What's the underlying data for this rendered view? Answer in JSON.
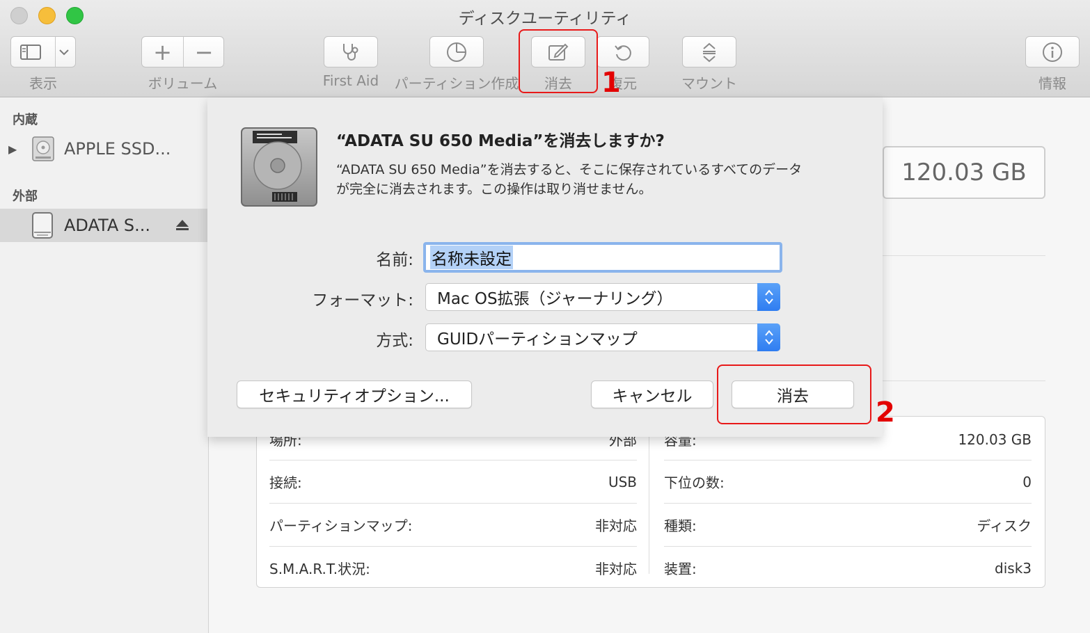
{
  "window": {
    "title": "ディスクユーティリティ"
  },
  "toolbar": {
    "view_label": "表示",
    "volume_label": "ボリューム",
    "first_aid_label": "First Aid",
    "partition_label": "パーティション作成",
    "erase_label": "消去",
    "restore_label": "復元",
    "mount_label": "マウント",
    "info_label": "情報"
  },
  "sidebar": {
    "internal_header": "内蔵",
    "internal_items": [
      {
        "label": "APPLE SSD..."
      }
    ],
    "external_header": "外部",
    "external_items": [
      {
        "label": "ADATA S..."
      }
    ]
  },
  "detail": {
    "capacity": "120.03 GB",
    "info_left": [
      {
        "label": "場所:",
        "value": "外部"
      },
      {
        "label": "接続:",
        "value": "USB"
      },
      {
        "label": "パーティションマップ:",
        "value": "非対応"
      },
      {
        "label": "S.M.A.R.T.状況:",
        "value": "非対応"
      }
    ],
    "info_right": [
      {
        "label": "容量:",
        "value": "120.03 GB"
      },
      {
        "label": "下位の数:",
        "value": "0"
      },
      {
        "label": "種類:",
        "value": "ディスク"
      },
      {
        "label": "装置:",
        "value": "disk3"
      }
    ]
  },
  "dialog": {
    "title": "“ADATA SU 650 Media”を消去しますか?",
    "message_line1": "“ADATA SU 650 Media”を消去すると、そこに保存されているすべてのデータ",
    "message_line2": "が完全に消去されます。この操作は取り消せません。",
    "name_label": "名前:",
    "name_value": "名称未設定",
    "format_label": "フォーマット:",
    "format_value": "Mac OS拡張（ジャーナリング）",
    "scheme_label": "方式:",
    "scheme_value": "GUIDパーティションマップ",
    "security_button": "セキュリティオプション...",
    "cancel_button": "キャンセル",
    "erase_button": "消去"
  },
  "annotations": {
    "step1": "1",
    "step2": "2",
    "color": "#e30000"
  }
}
